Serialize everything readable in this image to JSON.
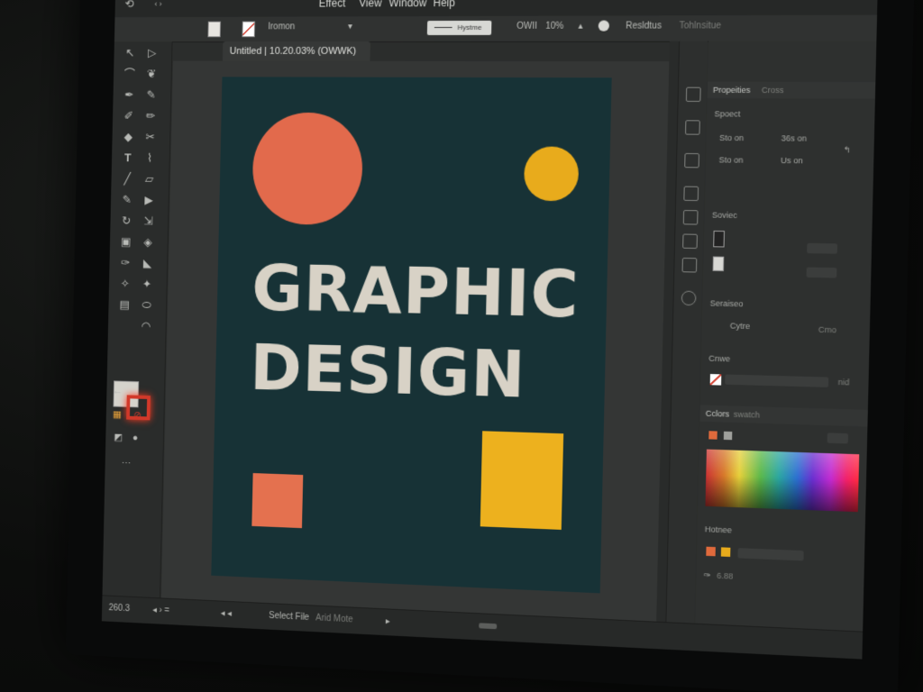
{
  "menubar": {
    "items": [
      "Effect",
      "View",
      "Window",
      "Help"
    ]
  },
  "controlbar": {
    "align_label": "Iromon",
    "stroke_profile": "Hystme",
    "opacity_label": "OWII",
    "opacity_value": "10%",
    "style_label": "Resldtus",
    "extra_label": "Tohlnsitue"
  },
  "document": {
    "tab_title": "Untitled | 10.20.03% (OWWK)"
  },
  "artboard": {
    "headline_line1": "GRAPHIC",
    "headline_line2": "DESIGN",
    "colors": {
      "background": "#173236",
      "coral": "#e26a4c",
      "gold": "#e8ab1c",
      "text": "#d8d2c6"
    }
  },
  "panels": {
    "properties_tab": "Propeities",
    "second_tab": "Cross",
    "speed_label": "Spoect",
    "row1_a": "Sto on",
    "row1_b": "36s on",
    "row2_a": "Sto on",
    "row2_b": "Us on",
    "group2_label": "Soviec",
    "group3_label": "Seraiseo",
    "group3_value": "Cytre",
    "group3_field": "Cmo",
    "group4_label": "Cnwe",
    "group4_field": "nid",
    "color_label": "Cclors",
    "color_tab2": "swatch",
    "harmony_label": "Hotnee",
    "swatch_value": "6.88",
    "accent_stroke": "#d2392a"
  },
  "statusbar": {
    "zoom": "260.3",
    "tool_name": "Select File",
    "tool_hint": "Arid Mote"
  }
}
